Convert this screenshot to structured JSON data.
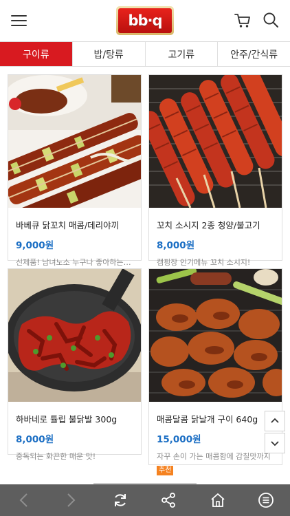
{
  "header": {
    "logo_text": "bb·q",
    "menu_icon": "hamburger-menu-icon",
    "cart_icon": "cart-icon",
    "search_icon": "search-icon"
  },
  "tabs": [
    {
      "label": "구이류",
      "active": true
    },
    {
      "label": "밥/탕류",
      "active": false
    },
    {
      "label": "고기류",
      "active": false
    },
    {
      "label": "안주/간식류",
      "active": false
    }
  ],
  "products": [
    {
      "name": "바베큐 닭꼬치 매콤/데리야끼",
      "price": "9,000원",
      "desc": "신제품! 남녀노소 누구나 좋아하는…",
      "badge": ""
    },
    {
      "name": "꼬치 소시지 2종 청양/불고기",
      "price": "8,000원",
      "desc": "캠핑장 인기메뉴 꼬치 소시지!",
      "badge": ""
    },
    {
      "name": "하바네로 튤립 불닭발 300g",
      "price": "8,000원",
      "desc": "중독되는 화끈한 매운 맛!",
      "badge": ""
    },
    {
      "name": "매콤달콤 닭날개 구이 640g",
      "price": "15,000원",
      "desc": "자꾸 손이 가는 매콤함에 감칠맛까지",
      "badge": "추천"
    }
  ],
  "colors": {
    "accent": "#d81a20",
    "price": "#1c6fc4",
    "badge": "#f58220",
    "bottombar": "#5e5e5e"
  }
}
